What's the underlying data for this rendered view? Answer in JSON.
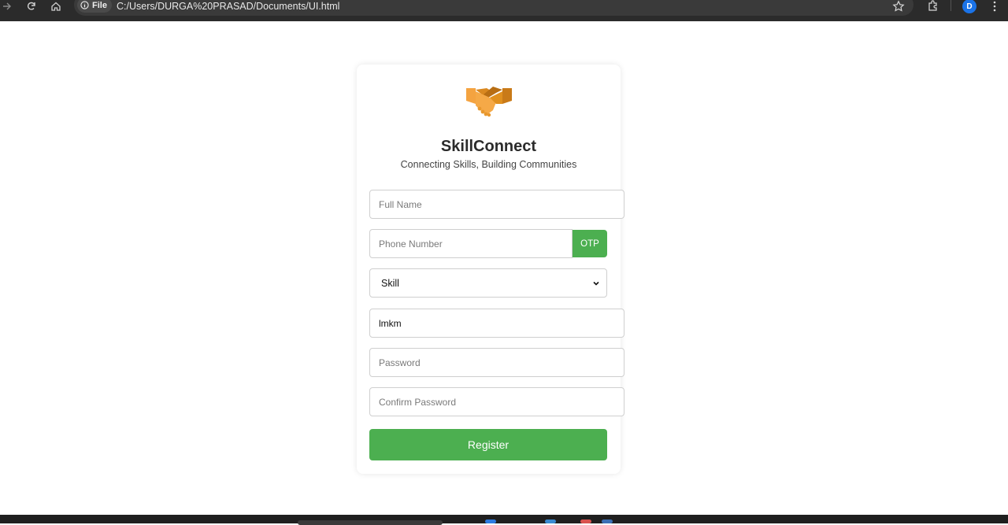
{
  "browser": {
    "file_chip_label": "File",
    "url": "C:/Users/DURGA%20PRASAD/Documents/UI.html",
    "profile_initial": "D"
  },
  "card": {
    "logo_icon": "handshake-icon",
    "title": "SkillConnect",
    "tagline": "Connecting Skills, Building Communities"
  },
  "form": {
    "full_name": {
      "placeholder": "Full Name",
      "value": ""
    },
    "phone": {
      "placeholder": "Phone Number",
      "value": ""
    },
    "otp_label": "OTP",
    "skill": {
      "selected": "Skill"
    },
    "text_field": {
      "value": "lmkm"
    },
    "password": {
      "placeholder": "Password",
      "value": ""
    },
    "confirm_password": {
      "placeholder": "Confirm Password",
      "value": ""
    },
    "register_label": "Register"
  },
  "colors": {
    "accent_green": "#4caf50",
    "logo_orange": "#f4a340",
    "chrome_dark": "#2b2b2b"
  }
}
